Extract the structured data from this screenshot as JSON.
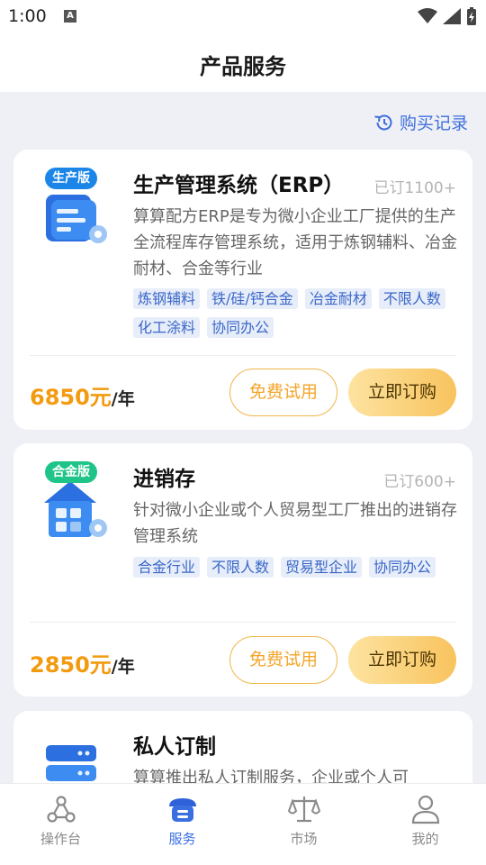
{
  "status": {
    "time": "1:00",
    "notification_glyph": "A"
  },
  "header": {
    "title": "产品服务"
  },
  "purchase_record": {
    "label": "购买记录",
    "icon": "history-icon"
  },
  "products": [
    {
      "badge": "生产版",
      "badge_color": "#1c86e8",
      "title": "生产管理系统（ERP）",
      "ordered": "已订1100+",
      "desc": "算算配方ERP是专为微小企业工厂提供的生产全流程库存管理系统，适用于炼钢辅料、冶金耐材、合金等行业",
      "tags": [
        "炼钢辅料",
        "铁/硅/钙合金",
        "冶金耐材",
        "不限人数",
        "化工涂料",
        "协同办公"
      ],
      "price": "6850元",
      "unit": "/年",
      "trial_label": "免费试用",
      "buy_label": "立即订购"
    },
    {
      "badge": "合金版",
      "badge_color": "#1fc488",
      "title": "进销存",
      "ordered": "已订600+",
      "desc": "针对微小企业或个人贸易型工厂推出的进销存管理系统",
      "tags": [
        "合金行业",
        "不限人数",
        "贸易型企业",
        "协同办公"
      ],
      "price": "2850元",
      "unit": "/年",
      "trial_label": "免费试用",
      "buy_label": "立即订购"
    },
    {
      "title": "私人订制",
      "desc": "算算推出私人订制服务，企业或个人可"
    }
  ],
  "tabbar": [
    {
      "label": "操作台",
      "icon": "workbench-icon"
    },
    {
      "label": "服务",
      "icon": "service-icon",
      "active": true
    },
    {
      "label": "市场",
      "icon": "market-scale-icon"
    },
    {
      "label": "我的",
      "icon": "profile-icon"
    }
  ],
  "colors": {
    "accent": "#3a6fe0",
    "price": "#f39b10",
    "tag_bg": "#e7edf9"
  }
}
